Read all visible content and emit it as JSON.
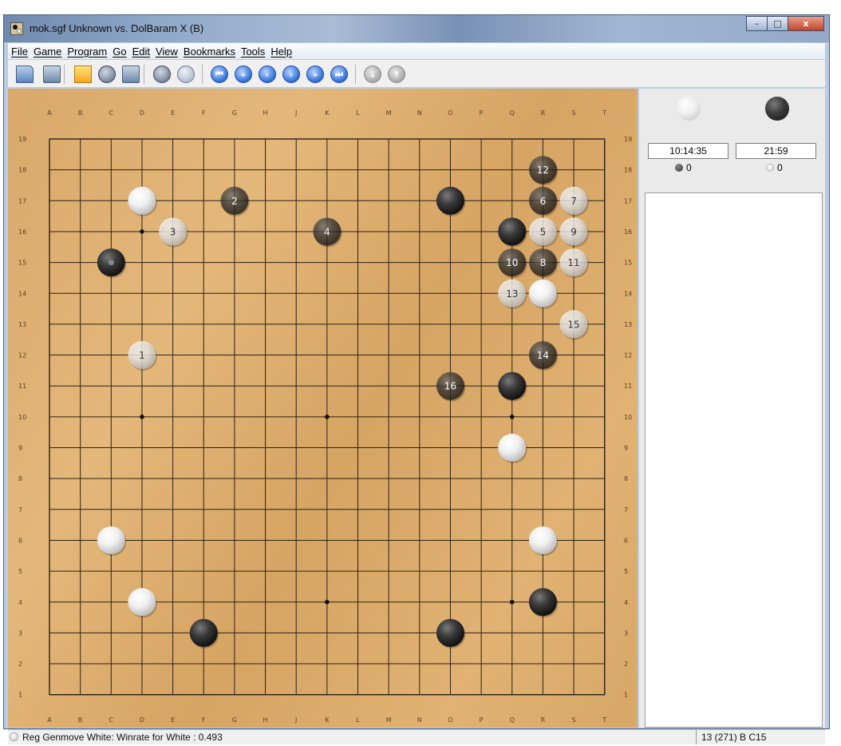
{
  "window": {
    "title": "mok.sgf  Unknown vs. DolBaram X (B)",
    "buttons": [
      "–",
      "□",
      "x"
    ]
  },
  "menu": [
    "File",
    "Game",
    "Program",
    "Go",
    "Edit",
    "View",
    "Bookmarks",
    "Tools",
    "Help"
  ],
  "toolbar": [
    {
      "name": "open-icon",
      "style": "folder"
    },
    {
      "name": "save-icon",
      "style": "square"
    },
    {
      "name": "new-game-icon",
      "style": "note"
    },
    {
      "name": "detach-program-icon",
      "style": "play"
    },
    {
      "name": "attach-program-icon",
      "style": "square"
    },
    {
      "name": "play-stone-icon",
      "style": "play"
    },
    {
      "name": "add-stone-icon",
      "style": "play2"
    },
    {
      "name": "beginning-icon",
      "style": "round",
      "glyph": "⏮"
    },
    {
      "name": "backward-ten-icon",
      "style": "round",
      "glyph": "«"
    },
    {
      "name": "backward-icon",
      "style": "round",
      "glyph": "‹"
    },
    {
      "name": "forward-icon",
      "style": "round",
      "glyph": "›"
    },
    {
      "name": "forward-ten-icon",
      "style": "round",
      "glyph": "»"
    },
    {
      "name": "end-icon",
      "style": "round",
      "glyph": "⏭"
    },
    {
      "name": "next-variation-icon",
      "style": "round-disabled",
      "glyph": "↓"
    },
    {
      "name": "previous-variation-icon",
      "style": "round-disabled",
      "glyph": "↑"
    }
  ],
  "board": {
    "size": 19,
    "columns": [
      "A",
      "B",
      "C",
      "D",
      "E",
      "F",
      "G",
      "H",
      "J",
      "K",
      "L",
      "M",
      "N",
      "O",
      "P",
      "Q",
      "R",
      "S",
      "T"
    ],
    "rows": [
      "19",
      "18",
      "17",
      "16",
      "15",
      "14",
      "13",
      "12",
      "11",
      "10",
      "9",
      "8",
      "7",
      "6",
      "5",
      "4",
      "3",
      "2",
      "1"
    ],
    "star_points": [
      "D16",
      "K16",
      "Q16",
      "D10",
      "K10",
      "Q10",
      "D4",
      "K4",
      "Q4"
    ],
    "stones": [
      {
        "pos": "D17",
        "color": "white",
        "label": ""
      },
      {
        "pos": "G17",
        "color": "black",
        "label": "2"
      },
      {
        "pos": "O17",
        "color": "black",
        "label": ""
      },
      {
        "pos": "R18",
        "color": "black",
        "label": "12"
      },
      {
        "pos": "R17",
        "color": "black",
        "label": "6"
      },
      {
        "pos": "S17",
        "color": "white",
        "label": "7"
      },
      {
        "pos": "E16",
        "color": "white",
        "label": "3"
      },
      {
        "pos": "K16",
        "color": "black",
        "label": "4"
      },
      {
        "pos": "Q16",
        "color": "black",
        "label": ""
      },
      {
        "pos": "R16",
        "color": "white",
        "label": "5"
      },
      {
        "pos": "S16",
        "color": "white",
        "label": "9"
      },
      {
        "pos": "C15",
        "color": "black",
        "label": "",
        "last": true
      },
      {
        "pos": "Q15",
        "color": "black",
        "label": "10"
      },
      {
        "pos": "R15",
        "color": "black",
        "label": "8"
      },
      {
        "pos": "S15",
        "color": "white",
        "label": "11"
      },
      {
        "pos": "Q14",
        "color": "white",
        "label": "13"
      },
      {
        "pos": "R14",
        "color": "white",
        "label": ""
      },
      {
        "pos": "S13",
        "color": "white",
        "label": "15"
      },
      {
        "pos": "D12",
        "color": "white",
        "label": "1"
      },
      {
        "pos": "R12",
        "color": "black",
        "label": "14"
      },
      {
        "pos": "O11",
        "color": "black",
        "label": "16"
      },
      {
        "pos": "Q11",
        "color": "black",
        "label": ""
      },
      {
        "pos": "Q9",
        "color": "white",
        "label": ""
      },
      {
        "pos": "C6",
        "color": "white",
        "label": ""
      },
      {
        "pos": "R6",
        "color": "white",
        "label": ""
      },
      {
        "pos": "D4",
        "color": "white",
        "label": ""
      },
      {
        "pos": "R4",
        "color": "black",
        "label": ""
      },
      {
        "pos": "F3",
        "color": "black",
        "label": ""
      },
      {
        "pos": "O3",
        "color": "black",
        "label": ""
      }
    ]
  },
  "players": {
    "white": {
      "time": "10:14:35",
      "captured": "0"
    },
    "black": {
      "time": "21:59",
      "captured": "0"
    }
  },
  "status": {
    "message": "Reg Genmove White: Winrate for White : 0.493",
    "move_info": "13 (271) B C15"
  }
}
